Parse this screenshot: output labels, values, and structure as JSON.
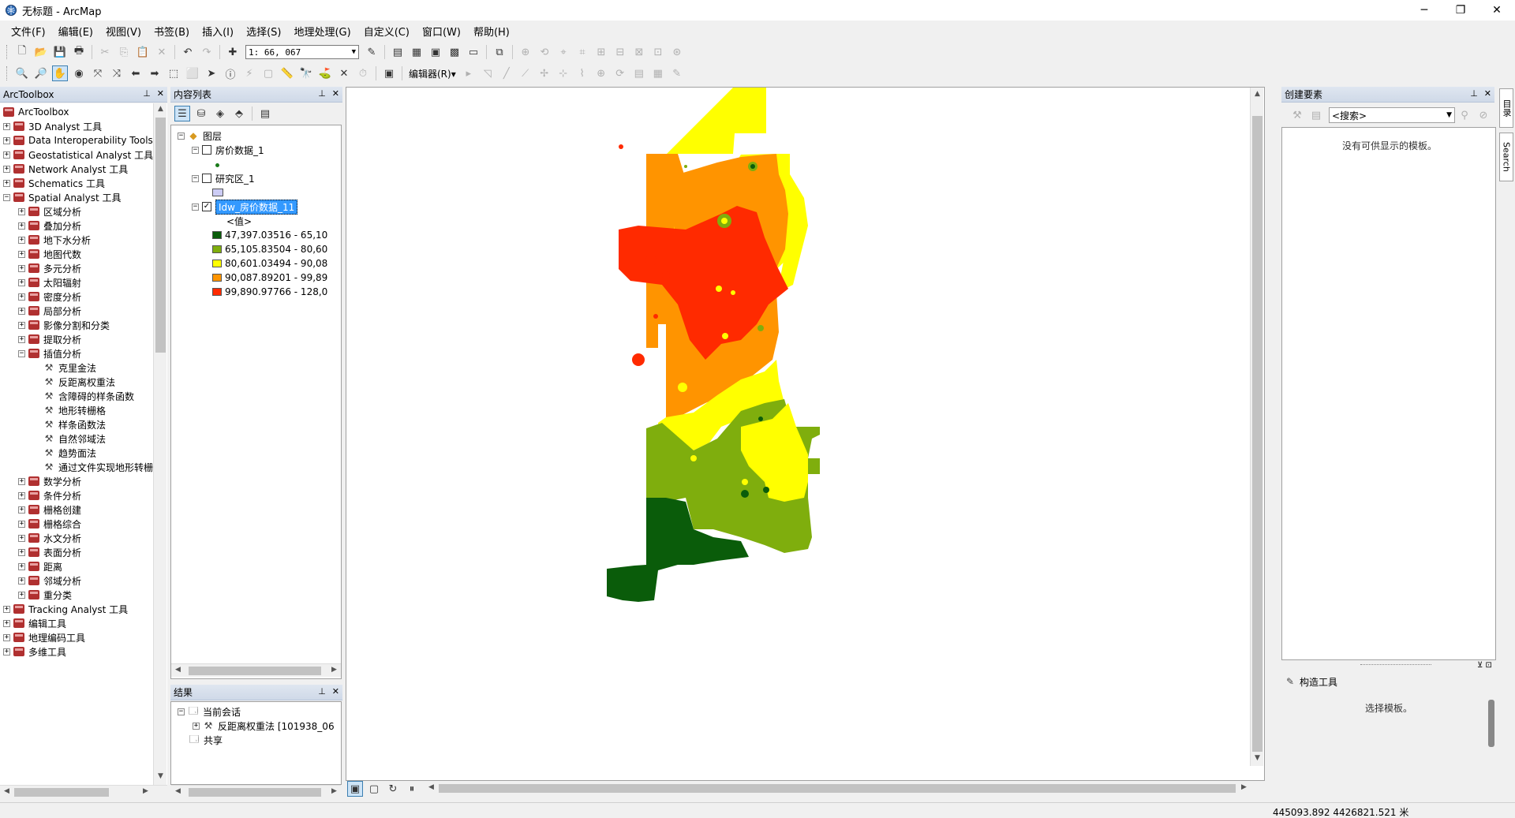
{
  "window": {
    "title": "无标题 - ArcMap",
    "minimize": "─",
    "maximize": "❐",
    "close": "✕"
  },
  "menubar": [
    "文件(F)",
    "编辑(E)",
    "视图(V)",
    "书签(B)",
    "插入(I)",
    "选择(S)",
    "地理处理(G)",
    "自定义(C)",
    "窗口(W)",
    "帮助(H)"
  ],
  "toolbar": {
    "scale": "1: 66, 067",
    "editor_label": "编辑器(R)▾"
  },
  "arctoolbox": {
    "title": "ArcToolbox",
    "root": "ArcToolbox",
    "items": [
      {
        "label": "3D Analyst 工具",
        "expanded": false
      },
      {
        "label": "Data Interoperability Tools",
        "expanded": false
      },
      {
        "label": "Geostatistical Analyst 工具",
        "expanded": false
      },
      {
        "label": "Network Analyst 工具",
        "expanded": false
      },
      {
        "label": "Schematics 工具",
        "expanded": false
      },
      {
        "label": "Spatial Analyst 工具",
        "expanded": true
      }
    ],
    "spatial_children": [
      "区域分析",
      "叠加分析",
      "地下水分析",
      "地图代数",
      "多元分析",
      "太阳辐射",
      "密度分析",
      "局部分析",
      "影像分割和分类",
      "提取分析",
      "插值分析"
    ],
    "interp_tools": [
      "克里金法",
      "反距离权重法",
      "含障碍的样条函数",
      "地形转栅格",
      "样条函数法",
      "自然邻域法",
      "趋势面法",
      "通过文件实现地形转栅格"
    ],
    "spatial_children_after": [
      "数学分析",
      "条件分析",
      "栅格创建",
      "栅格综合",
      "水文分析",
      "表面分析",
      "距离",
      "邻域分析",
      "重分类"
    ],
    "items_after": [
      "Tracking Analyst 工具",
      "编辑工具",
      "地理编码工具",
      "多维工具"
    ]
  },
  "toc": {
    "title": "内容列表",
    "root": "图层",
    "layers": [
      {
        "name": "房价数据_1",
        "checked": false
      },
      {
        "name": "研究区_1",
        "checked": false
      },
      {
        "name": "Idw_房价数据_11",
        "checked": true
      }
    ],
    "value_header": "<值>",
    "legend": [
      {
        "label": "47,397.03516 - 65,10",
        "color": "#0a5c0a"
      },
      {
        "label": "65,105.83504 - 80,60",
        "color": "#7fae0d"
      },
      {
        "label": "80,601.03494 - 90,08",
        "color": "#ffff00"
      },
      {
        "label": "90,087.89201 - 99,89",
        "color": "#ff9400"
      },
      {
        "label": "99,890.97766 - 128,0",
        "color": "#ff2a00"
      }
    ]
  },
  "results": {
    "title": "结果",
    "session": "当前会话",
    "entry": "反距离权重法 [101938_06",
    "shared": "共享"
  },
  "create_features": {
    "title": "创建要素",
    "search_placeholder": "<搜索>",
    "empty_msg": "没有可供显示的模板。",
    "construct_title": "构造工具",
    "construct_msg": "选择模板。"
  },
  "side_tabs": [
    "目录",
    "Search"
  ],
  "status": {
    "coords": "445093.892  4426821.521 米"
  },
  "colors": {
    "class1": "#0a5c0a",
    "class2": "#7fae0d",
    "class3": "#ffff00",
    "class4": "#ff9400",
    "class5": "#ff2a00",
    "selection": "#3399ff",
    "panel_header": "#dfe6f0"
  }
}
